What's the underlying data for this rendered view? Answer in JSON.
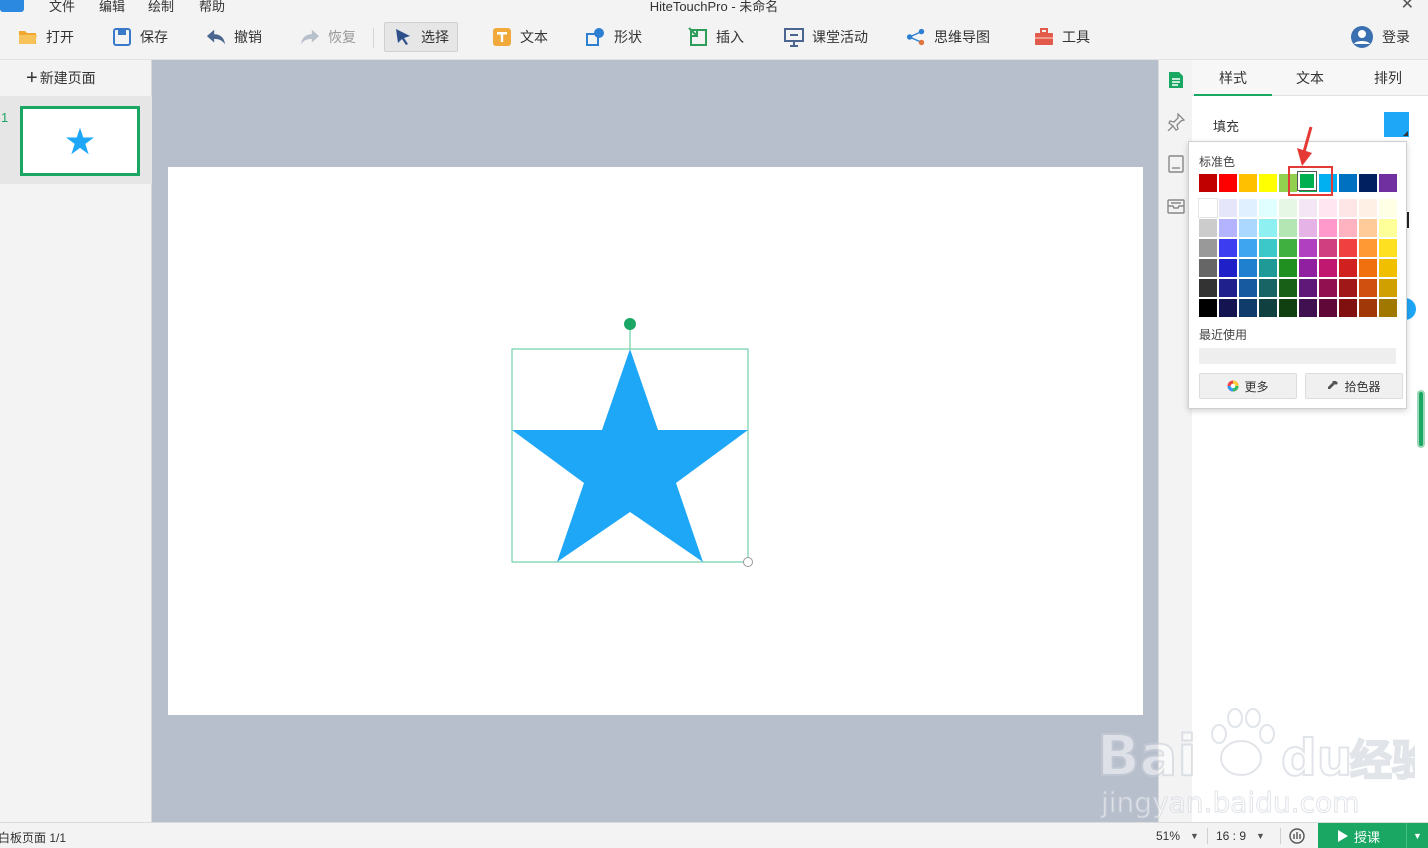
{
  "window": {
    "title": "HiteTouchPro - 未命名",
    "menu": [
      "文件",
      "编辑",
      "绘制",
      "帮助"
    ]
  },
  "toolbar": {
    "open": "打开",
    "save": "保存",
    "undo": "撤销",
    "redo": "恢复",
    "select": "选择",
    "text": "文本",
    "shape": "形状",
    "insert": "插入",
    "activity": "课堂活动",
    "mindmap": "思维导图",
    "tools": "工具",
    "login": "登录"
  },
  "pages": {
    "new_page": "新建页面",
    "items": [
      {
        "number": "1"
      }
    ]
  },
  "props": {
    "tabs": [
      "样式",
      "文本",
      "排列"
    ],
    "fill_label": "填充",
    "fill_color": "#1ea6f7"
  },
  "picker": {
    "standard_label": "标准色",
    "standard_colors": [
      "#c00000",
      "#ff0000",
      "#ffc000",
      "#ffff00",
      "#92d050",
      "#00b050",
      "#00b0f0",
      "#0070c0",
      "#002060",
      "#7030a0"
    ],
    "selected_index": 5,
    "palette": [
      [
        "#ffffff",
        "#e6e6fa",
        "#e0f0ff",
        "#e0ffff",
        "#e6f7e6",
        "#f5e6f5",
        "#ffe6f0",
        "#ffe6e6",
        "#fff0e6",
        "#ffffe6"
      ],
      [
        "#cccccc",
        "#b3b3ff",
        "#aad8ff",
        "#8ef0f0",
        "#b3e6b3",
        "#e6b3e6",
        "#ff99cc",
        "#ffb3c1",
        "#ffcc99",
        "#ffff99"
      ],
      [
        "#999999",
        "#3c3cf0",
        "#3ea6f0",
        "#3cc8c8",
        "#40b040",
        "#b040c0",
        "#d04080",
        "#f04040",
        "#ff9933",
        "#ffe020"
      ],
      [
        "#666666",
        "#2020c8",
        "#2080d0",
        "#209a96",
        "#209020",
        "#9020a0",
        "#c01870",
        "#d02020",
        "#f07010",
        "#f0c000"
      ],
      [
        "#333333",
        "#20208c",
        "#185aa0",
        "#186464",
        "#186018",
        "#601878",
        "#901050",
        "#a01818",
        "#d05010",
        "#d0a000"
      ],
      [
        "#000000",
        "#141450",
        "#103c6c",
        "#104040",
        "#104010",
        "#401050",
        "#600838",
        "#801010",
        "#a03808",
        "#a07800"
      ]
    ],
    "recent_label": "最近使用",
    "more_label": "更多",
    "eyedropper_label": "拾色器"
  },
  "status": {
    "pages": "白板页面 1/1",
    "zoom": "51%",
    "ratio": "16 : 9",
    "teach": "授课"
  },
  "colors": {
    "accent": "#1aa763",
    "shape_fill": "#1ea6f7",
    "canvas_bg": "#b7bfcc",
    "highlight": "#e53935"
  },
  "watermark": {
    "brand": "Bai",
    "brand2": "du",
    "brand_cn": "经验",
    "url": "jingyan.baidu.com"
  }
}
